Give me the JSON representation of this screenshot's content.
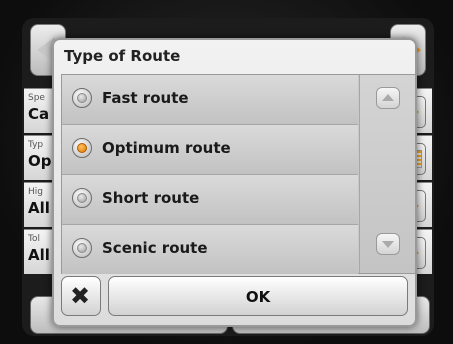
{
  "background": {
    "settings_rows": [
      {
        "small": "Spe",
        "big": "Ca",
        "side_icon": "chevron-right-icon"
      },
      {
        "small": "Typ",
        "big": "Op",
        "side_icon": "list-icon"
      },
      {
        "small": "Hig",
        "big": "All",
        "side_icon": "chevron-right-icon"
      },
      {
        "small": "Tol",
        "big": "All",
        "side_icon": "chevron-right-icon"
      }
    ]
  },
  "dialog": {
    "title": "Type of Route",
    "options": [
      {
        "label": "Fast route",
        "selected": false
      },
      {
        "label": "Optimum route",
        "selected": true
      },
      {
        "label": "Short route",
        "selected": false
      },
      {
        "label": "Scenic route",
        "selected": false
      }
    ],
    "cancel_icon": "close-icon",
    "ok_label": "OK"
  },
  "colors": {
    "accent": "#f0a020",
    "selected_radio": "#e07a00"
  }
}
